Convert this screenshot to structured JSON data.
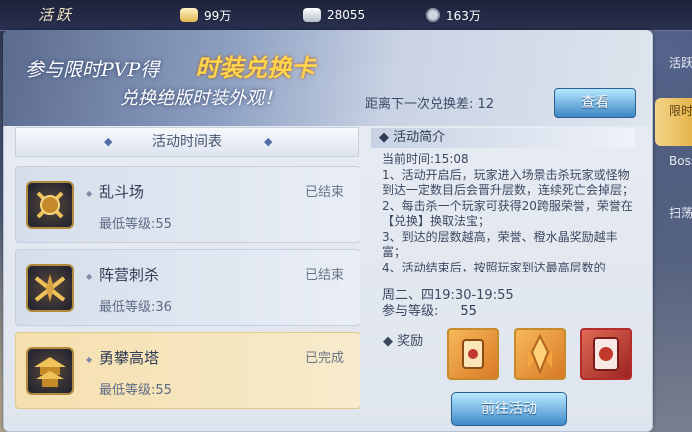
{
  "topbar": {
    "title": "活跃",
    "resources": [
      {
        "icon": "gold-ingot-icon",
        "value": "99万"
      },
      {
        "icon": "silver-ingot-icon",
        "value": "28055"
      },
      {
        "icon": "coin-icon",
        "value": "163万"
      }
    ]
  },
  "banner": {
    "line1": "参与限时PVP得",
    "highlight": "时装兑换卡",
    "line2": "兑换绝版时装外观！",
    "next_exchange": "距离下一次兑换差: 12",
    "view_button": "查看"
  },
  "right_tabs": [
    "活跃",
    "限时",
    "Boss",
    "扫荡"
  ],
  "schedule": {
    "header": "活动时间表",
    "items": [
      {
        "name": "乱斗场",
        "level": "最低等级:55",
        "status": "已结束",
        "icon": "crossed-swords-shield-icon"
      },
      {
        "name": "阵营刺杀",
        "level": "最低等级:36",
        "status": "已结束",
        "icon": "crossed-blades-icon"
      },
      {
        "name": "勇攀高塔",
        "level": "最低等级:55",
        "status": "已完成",
        "icon": "tower-icon"
      }
    ]
  },
  "intro": {
    "header": "活动简介",
    "current_time": "当前时间:15:08",
    "text": "1、活动开启后，玩家进入场景击杀玩家或怪物到达一定数目后会晋升层数，连续死亡会掉层；\n2、每击杀一个玩家可获得20跨服荣誉，荣誉在【兑换】换取法宝；\n3、到达的层数越高，荣誉、橙水晶奖励越丰富；\n4、活动结束后，按照玩家到达最高层数的",
    "schedule_time": "周二、四19:30-19:55",
    "join_label": "参与等级:",
    "join_level": "55",
    "reward_label": "奖励",
    "rewards": [
      "scroll-item-icon",
      "crystal-item-icon",
      "card-item-icon"
    ],
    "go_button": "前往活动"
  }
}
